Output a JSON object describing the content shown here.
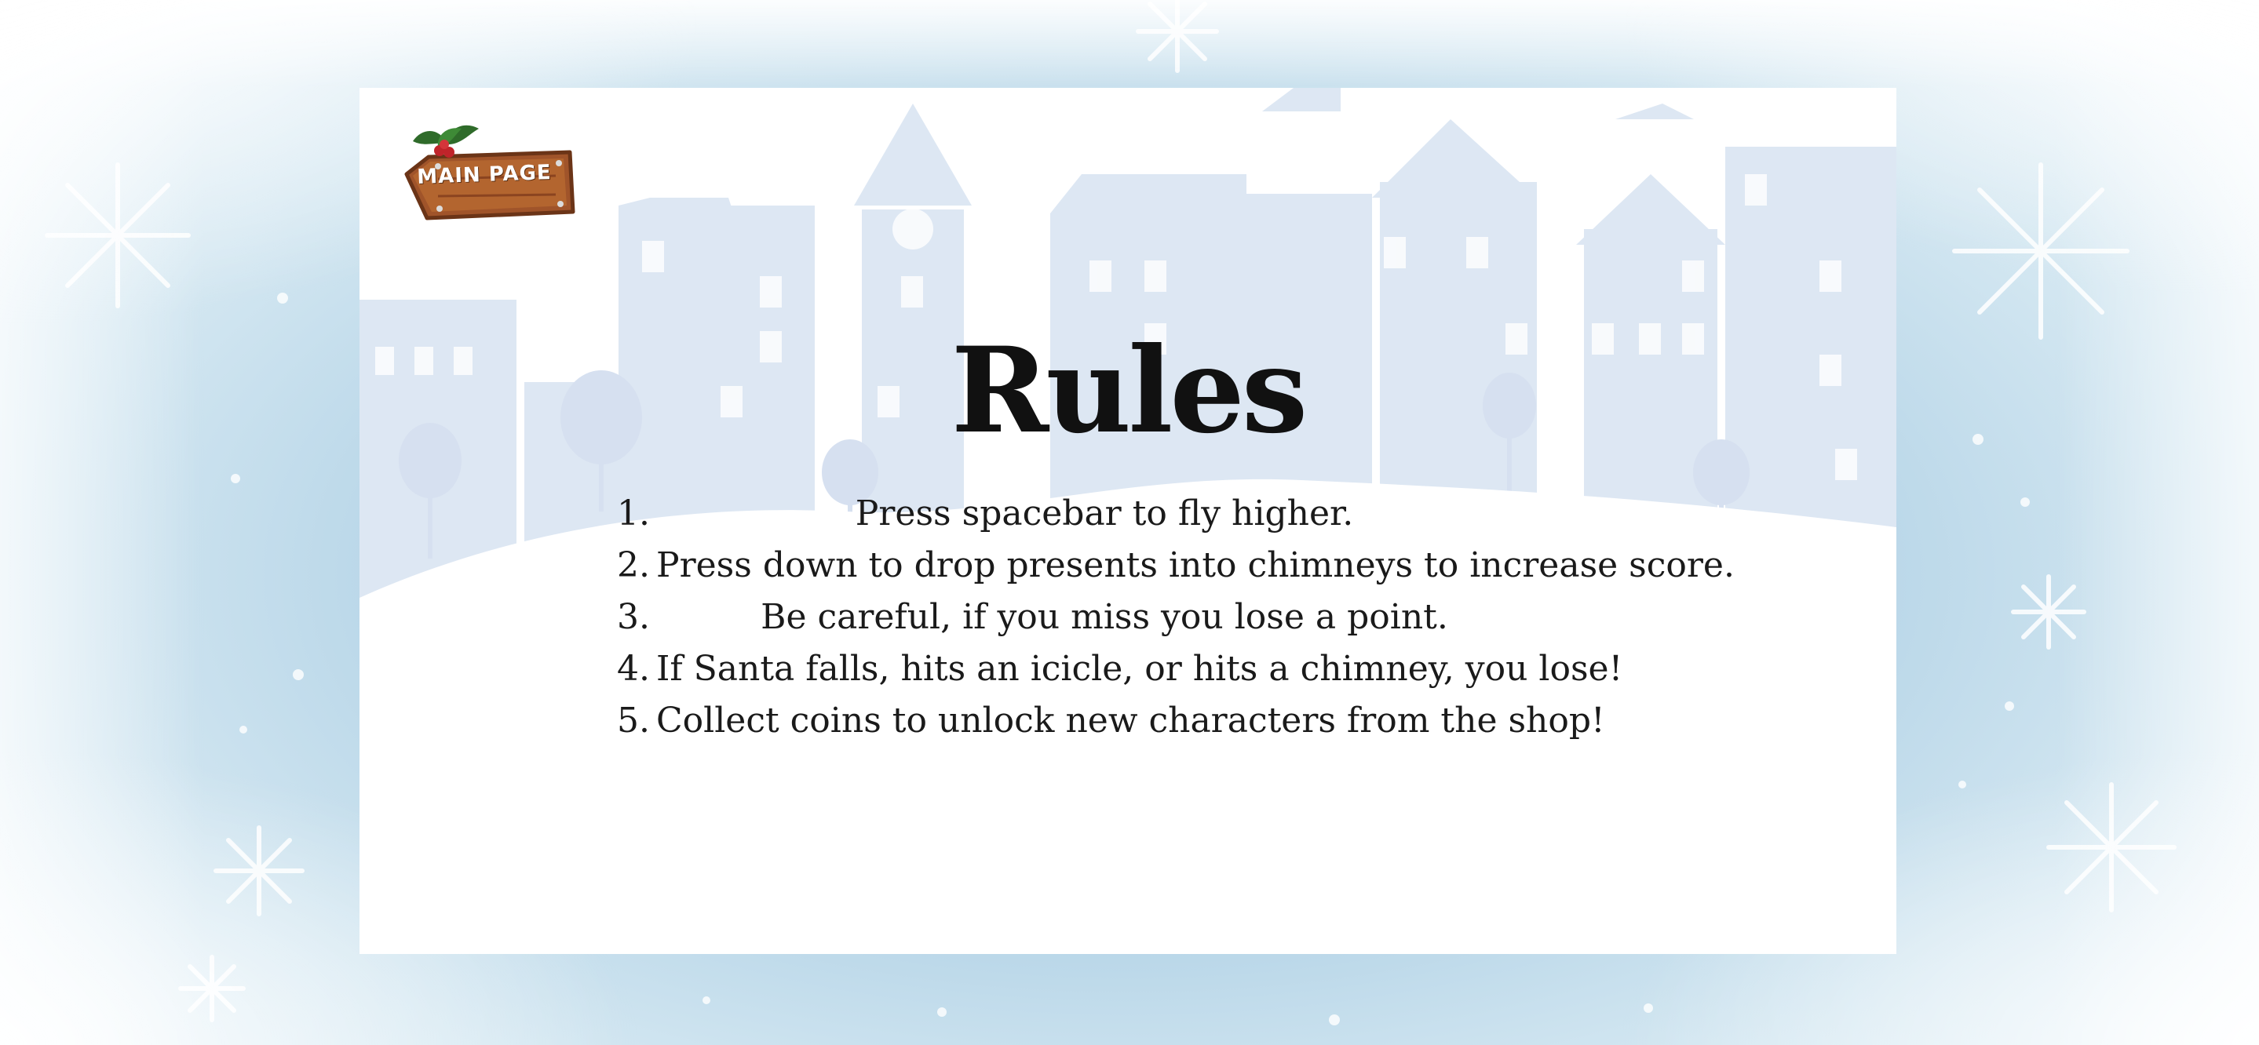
{
  "nav": {
    "main_page_label": "MAIN PAGE"
  },
  "page": {
    "title": "Rules"
  },
  "rules": [
    {
      "num": "1.",
      "text": "Press spacebar to fly higher."
    },
    {
      "num": "2.",
      "text": "Press down to drop presents into chimneys to increase score."
    },
    {
      "num": "3.",
      "text": "Be careful, if you miss you lose a point."
    },
    {
      "num": "4.",
      "text": "If Santa falls, hits an icicle, or hits a chimney, you lose!"
    },
    {
      "num": "5.",
      "text": "Collect coins to unlock new characters from the shop!"
    }
  ],
  "theme": {
    "background_blue": "#b8d6e8",
    "panel": "#ffffff",
    "village_silhouette": "#dde7f3",
    "sign_wood": "#a0542a",
    "holly_leaf": "#2f6b2a",
    "holly_berry": "#c0242a"
  }
}
